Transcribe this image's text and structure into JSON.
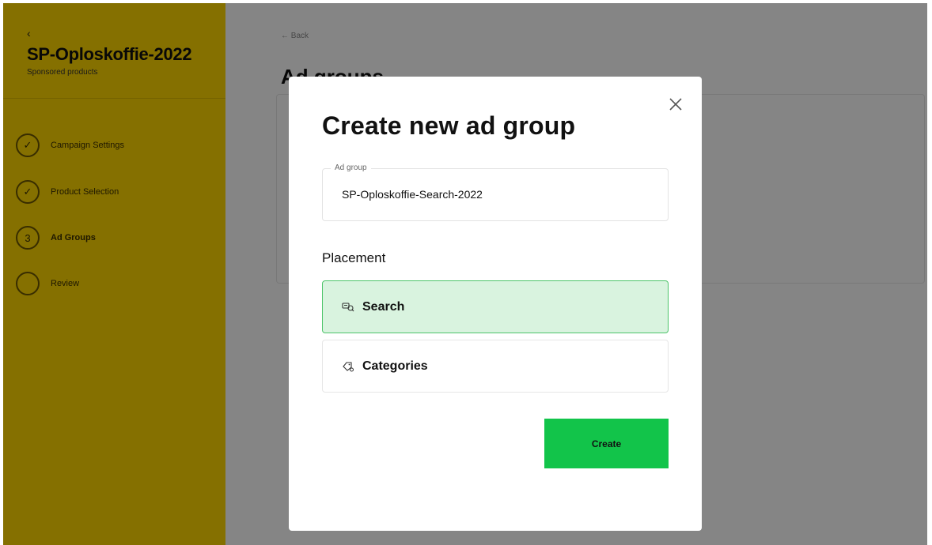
{
  "sidebar": {
    "back_label": "‹",
    "campaign_title": "SP-Oploskoffie-2022",
    "campaign_subtitle": "Sponsored products",
    "steps": [
      {
        "label": "Campaign Settings",
        "marker": "✓"
      },
      {
        "label": "Product Selection",
        "marker": "✓"
      },
      {
        "label": "Ad Groups",
        "marker": "3"
      },
      {
        "label": "Review",
        "marker": ""
      }
    ]
  },
  "main": {
    "back_label": "← Back",
    "title": "Ad groups"
  },
  "modal": {
    "title": "Create new ad group",
    "ad_group_field": {
      "legend": "Ad group",
      "value": "SP-Oploskoffie-Search-2022"
    },
    "placement_label": "Placement",
    "options": [
      {
        "label": "Search",
        "icon": "search-tag-icon",
        "selected": true
      },
      {
        "label": "Categories",
        "icon": "category-tag-icon",
        "selected": false
      }
    ],
    "create_label": "Create"
  },
  "colors": {
    "sidebar_bg": "#ffd600",
    "selected_option_bg": "#d9f3df",
    "selected_option_border": "#4dc46a",
    "create_button_bg": "#12c44a"
  }
}
